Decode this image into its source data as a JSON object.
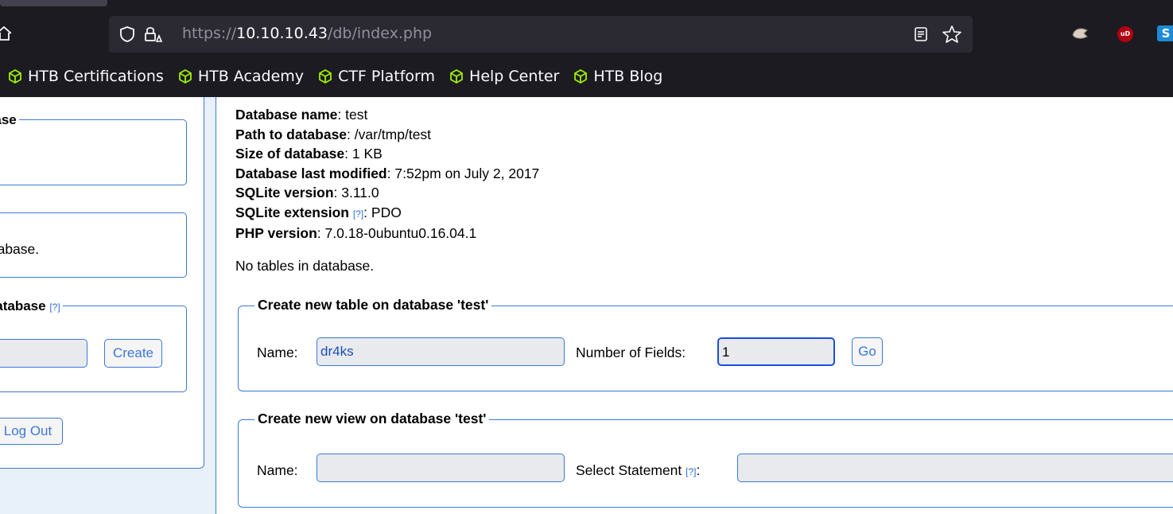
{
  "browser": {
    "url_scheme": "https://",
    "url_host": "10.10.10.43",
    "url_path": "/db/index.php",
    "bookmarks": [
      {
        "label": "HTB Certifications",
        "icon": "htb-cube-icon"
      },
      {
        "label": "HTB Academy",
        "icon": "htb-cube-icon"
      },
      {
        "label": "CTF Platform",
        "icon": "htb-cube-icon"
      },
      {
        "label": "Help Center",
        "icon": "htb-cube-icon"
      },
      {
        "label": "HTB Blog",
        "icon": "htb-cube-icon"
      }
    ],
    "extensions": {
      "ublock_label": "uD",
      "ext3_label": "S"
    },
    "colors": {
      "chrome_bg": "#1c1b22",
      "urlbar_bg": "#2b2a33",
      "bookmark_icon": "#9fef00"
    }
  },
  "sidebar": {
    "fieldset1_legend": "base",
    "fieldset2_text": "atabase.",
    "fieldset3_legend": "Database",
    "fieldset3_help": "[?]",
    "create_button": "Create",
    "logout_button": "Log Out"
  },
  "info": {
    "db_name_label": "Database name",
    "db_name_value": ": test",
    "path_label": "Path to database",
    "path_value": ": /var/tmp/test",
    "size_label": "Size of database",
    "size_value": ": 1 KB",
    "modified_label": "Database last modified",
    "modified_value": ": 7:52pm on July 2, 2017",
    "sqlite_version_label": "SQLite version",
    "sqlite_version_value": ": 3.11.0",
    "sqlite_ext_label": "SQLite extension",
    "sqlite_ext_help": "[?]",
    "sqlite_ext_value": ": PDO",
    "php_label": "PHP version",
    "php_value": ": 7.0.18-0ubuntu0.16.04.1"
  },
  "no_tables": "No tables in database.",
  "create_table": {
    "legend": "Create new table on database 'test'",
    "name_label": "Name:",
    "name_value": "dr4ks",
    "fields_label": "Number of Fields:",
    "fields_value": "1",
    "go_button": "Go"
  },
  "create_view": {
    "legend": "Create new view on database 'test'",
    "name_label": "Name:",
    "name_value": "",
    "statement_label": "Select Statement",
    "statement_help": "[?]",
    "statement_colon": ":",
    "statement_value": ""
  },
  "accent_color": "#3b78d8"
}
